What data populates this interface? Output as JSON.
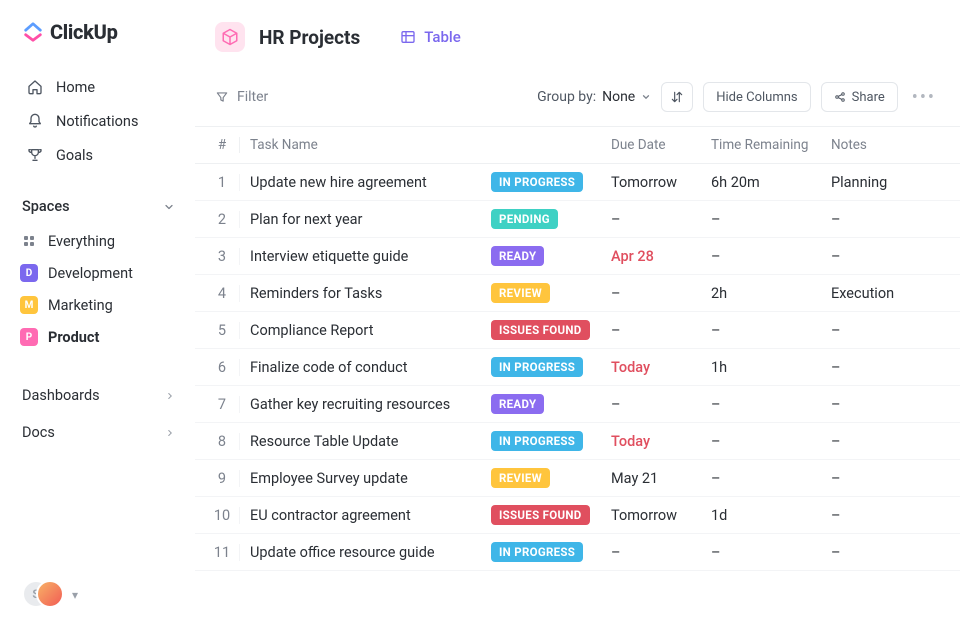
{
  "brand": {
    "name": "ClickUp"
  },
  "nav": {
    "items": [
      {
        "icon": "home",
        "label": "Home"
      },
      {
        "icon": "bell",
        "label": "Notifications"
      },
      {
        "icon": "trophy",
        "label": "Goals"
      }
    ]
  },
  "sidebar": {
    "spaces_label": "Spaces",
    "sections": [
      {
        "label": "Dashboards"
      },
      {
        "label": "Docs"
      }
    ]
  },
  "spaces": [
    {
      "label": "Everything",
      "kind": "everything",
      "color": ""
    },
    {
      "label": "Development",
      "kind": "letter",
      "letter": "D",
      "color": "#7b68ee"
    },
    {
      "label": "Marketing",
      "kind": "letter",
      "letter": "M",
      "color": "#ffc53d"
    },
    {
      "label": "Product",
      "kind": "letter",
      "letter": "P",
      "color": "#ff6bb3",
      "active": true
    }
  ],
  "header": {
    "title": "HR Projects",
    "view_label": "Table"
  },
  "toolbar": {
    "filter_label": "Filter",
    "group_by_label": "Group by:",
    "group_by_value": "None",
    "hide_columns_label": "Hide Columns",
    "share_label": "Share"
  },
  "columns": {
    "num": "#",
    "name": "Task Name",
    "due": "Due Date",
    "time": "Time Remaining",
    "notes": "Notes"
  },
  "status_colors": {
    "IN PROGRESS": "#3fb6e8",
    "PENDING": "#3fd1c4",
    "READY": "#8b6cf0",
    "REVIEW": "#ffc53d",
    "ISSUES FOUND": "#e04f5f"
  },
  "rows": [
    {
      "n": "1",
      "name": "Update new hire agreement",
      "status": "IN PROGRESS",
      "due": "Tomorrow",
      "due_red": false,
      "time": "6h 20m",
      "notes": "Planning"
    },
    {
      "n": "2",
      "name": "Plan for next year",
      "status": "PENDING",
      "due": "–",
      "due_red": false,
      "time": "–",
      "notes": "–"
    },
    {
      "n": "3",
      "name": "Interview etiquette guide",
      "status": "READY",
      "due": "Apr 28",
      "due_red": true,
      "time": "–",
      "notes": "–"
    },
    {
      "n": "4",
      "name": "Reminders for Tasks",
      "status": "REVIEW",
      "due": "–",
      "due_red": false,
      "time": "2h",
      "notes": "Execution"
    },
    {
      "n": "5",
      "name": "Compliance Report",
      "status": "ISSUES FOUND",
      "due": "–",
      "due_red": false,
      "time": "–",
      "notes": "–"
    },
    {
      "n": "6",
      "name": "Finalize code of conduct",
      "status": "IN PROGRESS",
      "due": "Today",
      "due_red": true,
      "time": "1h",
      "notes": "–"
    },
    {
      "n": "7",
      "name": "Gather key recruiting resources",
      "status": "READY",
      "due": "–",
      "due_red": false,
      "time": "–",
      "notes": "–"
    },
    {
      "n": "8",
      "name": "Resource Table Update",
      "status": "IN PROGRESS",
      "due": "Today",
      "due_red": true,
      "time": "–",
      "notes": "–"
    },
    {
      "n": "9",
      "name": "Employee Survey update",
      "status": "REVIEW",
      "due": "May 21",
      "due_red": false,
      "time": "–",
      "notes": "–"
    },
    {
      "n": "10",
      "name": "EU contractor agreement",
      "status": "ISSUES FOUND",
      "due": "Tomorrow",
      "due_red": false,
      "time": "1d",
      "notes": "–"
    },
    {
      "n": "11",
      "name": "Update office resource guide",
      "status": "IN PROGRESS",
      "due": "–",
      "due_red": false,
      "time": "–",
      "notes": "–"
    }
  ],
  "user": {
    "initial": "S"
  }
}
